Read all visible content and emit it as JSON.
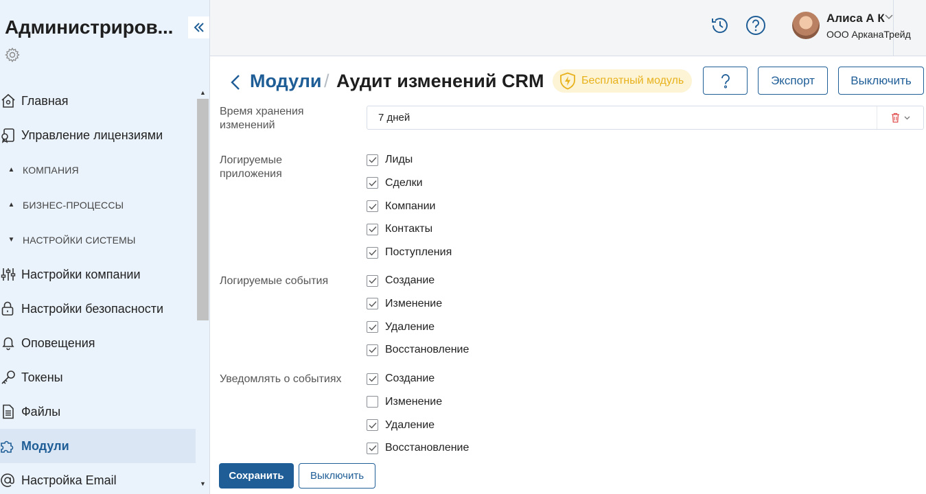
{
  "sidebar": {
    "title": "Администриров...",
    "items_top": [
      {
        "label": "Главная",
        "icon": "home-icon"
      },
      {
        "label": "Управление лицензиями",
        "icon": "license-icon"
      }
    ],
    "groups": [
      {
        "label": "КОМПАНИЯ",
        "state": "collapsed"
      },
      {
        "label": "БИЗНЕС-ПРОЦЕССЫ",
        "state": "collapsed"
      },
      {
        "label": "НАСТРОЙКИ СИСТЕМЫ",
        "state": "expanded"
      }
    ],
    "items": [
      {
        "label": "Настройки компании",
        "icon": "sliders-icon"
      },
      {
        "label": "Настройки безопасности",
        "icon": "lock-icon"
      },
      {
        "label": "Оповещения",
        "icon": "bell-icon"
      },
      {
        "label": "Токены",
        "icon": "key-icon"
      },
      {
        "label": "Файлы",
        "icon": "file-icon"
      },
      {
        "label": "Модули",
        "icon": "puzzle-icon",
        "active": true
      },
      {
        "label": "Настройка Email",
        "icon": "at-icon"
      }
    ]
  },
  "header": {
    "user_name": "Алиса А К",
    "user_org": "ООО АрканаТрейд"
  },
  "page": {
    "breadcrumb_link": "Модули",
    "breadcrumb_sep": "/",
    "title": "Аудит изменений CRM",
    "badge": "Бесплатный модуль",
    "export_label": "Экспорт",
    "disable_label": "Выключить"
  },
  "form": {
    "retention_label": "Время хранения изменений",
    "retention_value": "7 дней",
    "apps_label": "Логируемые приложения",
    "apps": [
      {
        "label": "Лиды",
        "checked": true
      },
      {
        "label": "Сделки",
        "checked": true
      },
      {
        "label": "Компании",
        "checked": true
      },
      {
        "label": "Контакты",
        "checked": true
      },
      {
        "label": "Поступления",
        "checked": true
      }
    ],
    "events_label": "Логируемые события",
    "events": [
      {
        "label": "Создание",
        "checked": true
      },
      {
        "label": "Изменение",
        "checked": true
      },
      {
        "label": "Удаление",
        "checked": true
      },
      {
        "label": "Восстановление",
        "checked": true
      }
    ],
    "notify_label": "Уведомлять о событиях",
    "notify": [
      {
        "label": "Создание",
        "checked": true
      },
      {
        "label": "Изменение",
        "checked": false
      },
      {
        "label": "Удаление",
        "checked": true
      },
      {
        "label": "Восстановление",
        "checked": true
      }
    ]
  },
  "footer": {
    "save_label": "Сохранить",
    "disable_label": "Выключить"
  },
  "colors": {
    "accent": "#1e5d96",
    "sidebar_bg": "#eaf2fb",
    "badge_bg": "#fdf3d5",
    "badge_fg": "#e8b21c",
    "delete_icon": "#e05050"
  }
}
